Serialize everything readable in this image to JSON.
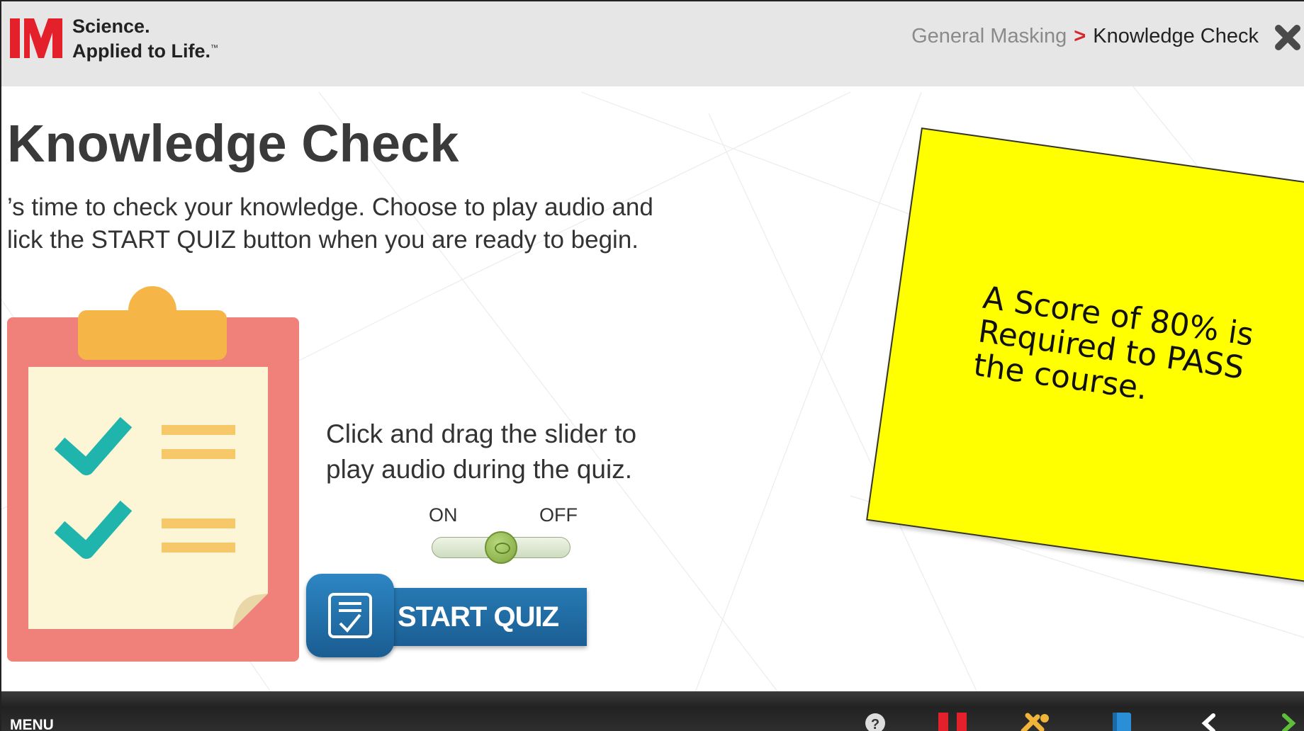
{
  "header": {
    "logo_line1": "Science.",
    "logo_line2": "Applied to Life.",
    "logo_tm": "™",
    "breadcrumb": {
      "parent": "General Masking",
      "separator": ">",
      "current": "Knowledge Check"
    },
    "close_icon": "close-icon"
  },
  "main": {
    "title": "Knowledge Check",
    "intro_line1": "’s time to check your knowledge. Choose to play audio and",
    "intro_line2": "lick the START QUIZ button when you are ready to begin.",
    "slider_instruction_line1": "Click and drag the slider to",
    "slider_instruction_line2": "play audio during the quiz.",
    "toggle": {
      "on_label": "ON",
      "off_label": "OFF",
      "position": 0.5
    },
    "start_quiz_label": "START QUIZ"
  },
  "sticky_note": {
    "line1": "A Score of 80% is",
    "line2": "Required to PASS",
    "line3": "the course.",
    "color": "#ffff00"
  },
  "bottom_bar": {
    "menu_label": "MENU",
    "icons": [
      "help-icon",
      "pause-icon",
      "tools-icon",
      "notebook-icon",
      "prev-icon",
      "next-icon"
    ]
  },
  "colors": {
    "brand_red": "#e4202a",
    "button_blue": "#1f6ea8",
    "check_teal": "#1fb5ad",
    "clipboard_red": "#f0807a",
    "paper_cream": "#fdf6d6"
  }
}
